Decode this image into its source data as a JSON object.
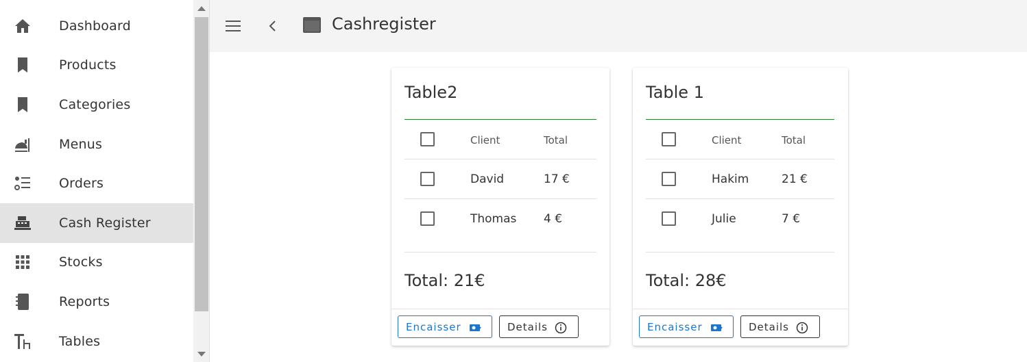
{
  "sidebar": {
    "items": [
      {
        "label": "Dashboard",
        "icon": "home-icon"
      },
      {
        "label": "Products",
        "icon": "bookmark-icon"
      },
      {
        "label": "Categories",
        "icon": "bookmark-icon"
      },
      {
        "label": "Menus",
        "icon": "food-bell-icon"
      },
      {
        "label": "Orders",
        "icon": "list-bullets-icon"
      },
      {
        "label": "Cash Register",
        "icon": "cash-register-icon",
        "active": true
      },
      {
        "label": "Stocks",
        "icon": "grid-dots-icon"
      },
      {
        "label": "Reports",
        "icon": "notebook-icon"
      },
      {
        "label": "Tables",
        "icon": "table-furniture-icon"
      }
    ]
  },
  "header": {
    "title": "Cashregister"
  },
  "table_header": {
    "client": "Client",
    "total": "Total"
  },
  "cards": [
    {
      "title": "Table2",
      "rows": [
        {
          "client": "David",
          "total": "17 €"
        },
        {
          "client": "Thomas",
          "total": "4 €"
        }
      ],
      "total_label": "Total: 21€",
      "encaisser_label": "Encaisser",
      "details_label": "Details"
    },
    {
      "title": "Table 1",
      "rows": [
        {
          "client": "Hakim",
          "total": "21 €"
        },
        {
          "client": "Julie",
          "total": "7 €"
        }
      ],
      "total_label": "Total: 28€",
      "encaisser_label": "Encaisser",
      "details_label": "Details"
    }
  ],
  "colors": {
    "accent": "#1976d2",
    "divider_green": "#2e7d32",
    "active_nav": "#e3e3e3",
    "header_bg": "#f4f4f4"
  }
}
